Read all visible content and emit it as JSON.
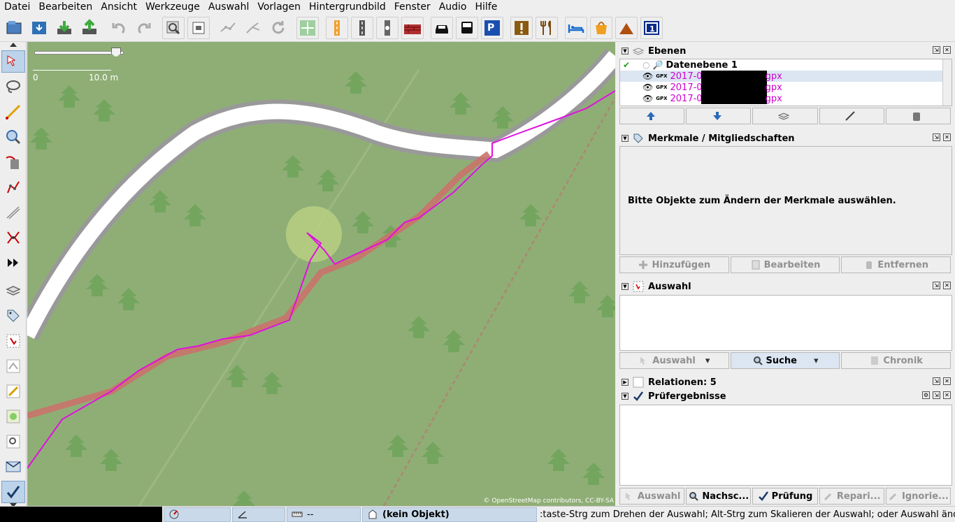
{
  "menu": [
    "Datei",
    "Bearbeiten",
    "Ansicht",
    "Werkzeuge",
    "Auswahl",
    "Vorlagen",
    "Hintergrundbild",
    "Fenster",
    "Audio",
    "Hilfe"
  ],
  "toolbar_icons": [
    "open-file",
    "save",
    "download",
    "upload",
    "undo",
    "redo",
    "preferences",
    "zoom-region",
    "map-paint",
    "tag-split",
    "refresh",
    "move",
    "road-orange",
    "road-gray",
    "road-path",
    "wall",
    "car",
    "bus",
    "parking-bike",
    "hazard",
    "restaurant",
    "hotel",
    "shop",
    "peak",
    "route-sign"
  ],
  "map": {
    "scale_min": "0",
    "scale_max": "10.0 m",
    "attribution": "© OpenStreetMap contributors, CC-BY-SA",
    "track_color": "#e010e0"
  },
  "panels": {
    "layers": {
      "title": "Ebenen",
      "datalayer": "Datenebene 1",
      "gpx_tag": "GPX",
      "tracks": [
        "2017-0",
        "2017-0",
        "2017-0"
      ],
      "track_suffix": "gpx"
    },
    "tags": {
      "title": "Merkmale / Mitgliedschaften",
      "empty_message": "Bitte Objekte zum Ändern der Merkmale auswählen.",
      "buttons": [
        "Hinzufügen",
        "Bearbeiten",
        "Entfernen"
      ]
    },
    "selection": {
      "title": "Auswahl",
      "buttons": [
        "Auswahl",
        "Suche",
        "Chronik"
      ]
    },
    "relations": {
      "title": "Relationen: 5"
    },
    "validator": {
      "title": "Prüfergebnisse",
      "buttons": [
        "Auswahl",
        "Nachsc...",
        "Prüfung",
        "Repari...",
        "Ignorie..."
      ]
    }
  },
  "status": {
    "distance": "--",
    "object": "(kein Objekt)",
    "help": ":taste-Strg zum Drehen der Auswahl; Alt-Strg zum Skalieren der Auswahl; oder Auswahl ändern"
  }
}
